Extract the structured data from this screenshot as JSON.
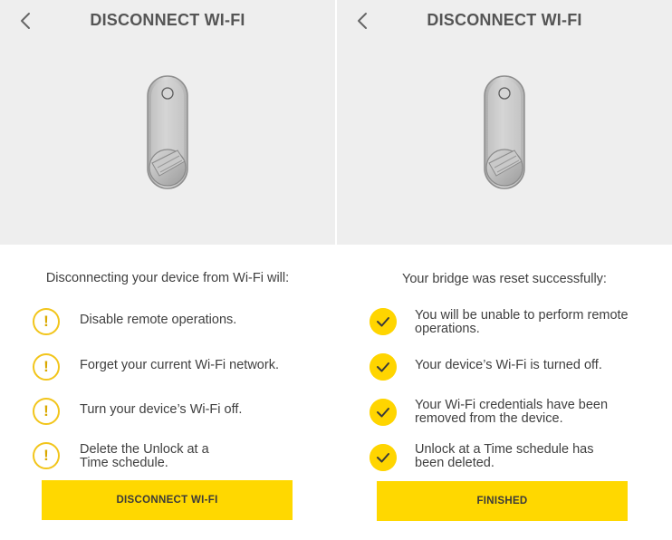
{
  "left_screen": {
    "header": {
      "title": "DISCONNECT WI-FI",
      "back_icon": "chevron-left-icon"
    },
    "intro": "Disconnecting your device from Wi-Fi will:",
    "items": [
      {
        "icon": "warning-icon",
        "glyph": "!",
        "text": "Disable remote operations."
      },
      {
        "icon": "warning-icon",
        "glyph": "!",
        "text": "Forget your current Wi-Fi network."
      },
      {
        "icon": "warning-icon",
        "glyph": "!",
        "text": "Turn your device’s Wi-Fi off."
      },
      {
        "icon": "warning-icon",
        "glyph": "!",
        "text": "Delete the Unlock at a Time schedule."
      }
    ],
    "button_label": "DISCONNECT WI-FI"
  },
  "right_screen": {
    "header": {
      "title": "DISCONNECT WI-FI",
      "back_icon": "chevron-left-icon"
    },
    "intro": "Your bridge was reset successfully:",
    "items": [
      {
        "icon": "checkmark-icon",
        "text": "You will be unable to perform remote operations."
      },
      {
        "icon": "checkmark-icon",
        "text": "Your device’s Wi-Fi is turned off."
      },
      {
        "icon": "checkmark-icon",
        "text": "Your Wi-Fi credentials have been removed from the device."
      },
      {
        "icon": "checkmark-icon",
        "text": "Unlock at a Time schedule has been deleted."
      }
    ],
    "button_label": "FINISHED"
  },
  "colors": {
    "accent_yellow": "#ffd800",
    "warning_outline": "#f2c51b",
    "hero_background": "#eeeeee",
    "text": "#3f3f3f",
    "title": "#555555"
  }
}
